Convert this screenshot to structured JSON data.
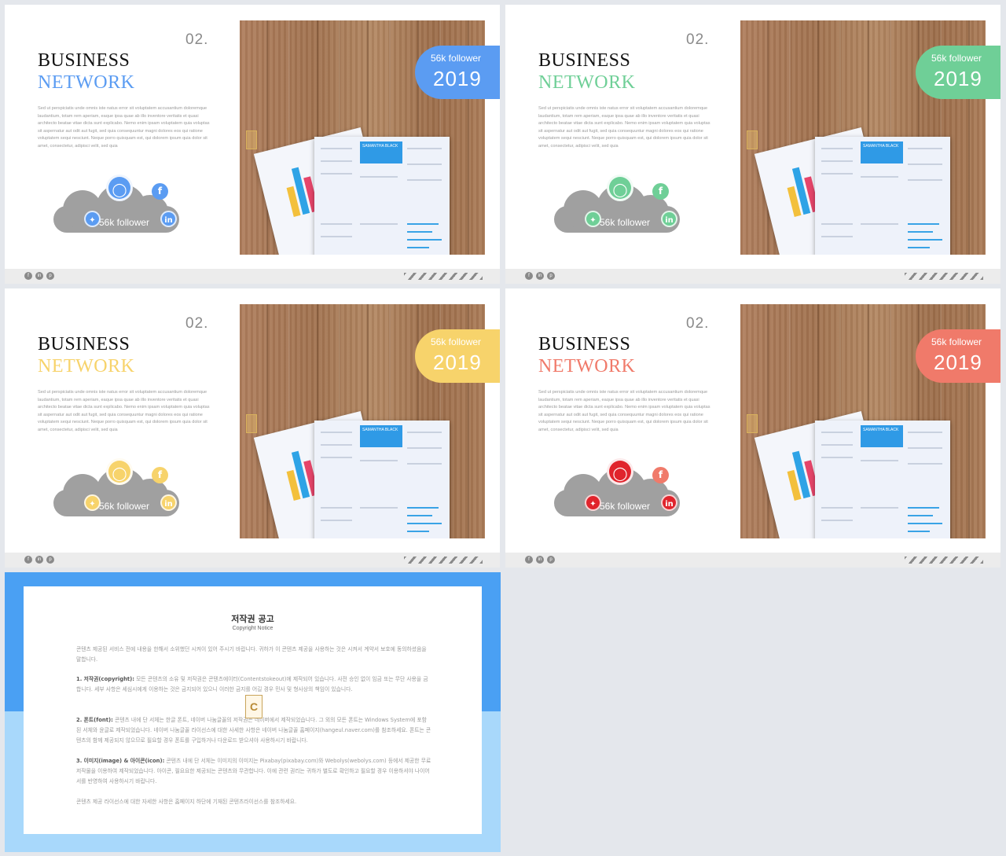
{
  "slides": [
    {
      "number": "02.",
      "title1": "BUSINESS",
      "title2": "NETWORK",
      "accent": "#5b9cf2",
      "badge_label": "56k follower",
      "badge_year": "2019",
      "cloud_label": "56k follower",
      "body": "Sed ut perspiciatis unde omnis iste natus error sit voluptatem accusantium doloremque laudantium, totam rem aperiam, eaque ipsa quae ab illo inventore veritatis et quasi architecto beatae vitae dicta sunt explicabo. Nemo enim ipsam voluptatem quia voluptas sit aspernatur aut odit aut fugit, sed quia consequuntur magni dolores eos qui ratione voluptatem sequi nesciunt. Neque porro quisquam est, qui dolorem ipsum quia dolor sit amet, consectetur, adipisci velit, sed quia"
    },
    {
      "number": "02.",
      "title1": "BUSINESS",
      "title2": "NETWORK",
      "accent": "#6fcf97",
      "badge_label": "56k follower",
      "badge_year": "2019",
      "cloud_label": "56k follower",
      "body": "Sed ut perspiciatis unde omnis iste natus error sit voluptatem accusantium doloremque laudantium, totam rem aperiam, eaque ipsa quae ab illo inventore veritatis et quasi architecto beatae vitae dicta sunt explicabo. Nemo enim ipsam voluptatem quia voluptas sit aspernatur aut odit aut fugit, sed quia consequuntur magni dolores eos qui ratione voluptatem sequi nesciunt. Neque porro quisquam est, qui dolorem ipsum quia dolor sit amet, consectetur, adipisci velit, sed quia"
    },
    {
      "number": "02.",
      "title1": "BUSINESS",
      "title2": "NETWORK",
      "accent": "#f7d36b",
      "badge_label": "56k follower",
      "badge_year": "2019",
      "cloud_label": "56k follower",
      "body": "Sed ut perspiciatis unde omnis iste natus error sit voluptatem accusantium doloremque laudantium, totam rem aperiam, eaque ipsa quae ab illo inventore veritatis et quasi architecto beatae vitae dicta sunt explicabo. Nemo enim ipsam voluptatem quia voluptas sit aspernatur aut odit aut fugit, sed quia consequuntur magni dolores eos qui ratione voluptatem sequi nesciunt. Neque porro quisquam est, qui dolorem ipsum quia dolor sit amet, consectetur, adipisci velit, sed quia"
    },
    {
      "number": "02.",
      "title1": "BUSINESS",
      "title2": "NETWORK",
      "accent": "#f07a6a",
      "icon_accent": "#e0242c",
      "badge_label": "56k follower",
      "badge_year": "2019",
      "cloud_label": "56k follower",
      "body": "Sed ut perspiciatis unde omnis iste natus error sit voluptatem accusantium doloremque laudantium, totam rem aperiam, eaque ipsa quae ab illo inventore veritatis et quasi architecto beatae vitae dicta sunt explicabo. Nemo enim ipsam voluptatem quia voluptas sit aspernatur aut odit aut fugit, sed quia consequuntur magni dolores eos qui ratione voluptatem sequi nesciunt. Neque porro quisquam est, qui dolorem ipsum quia dolor sit amet, consectetur, adipisci velit, sed quia"
    }
  ],
  "resume": {
    "name": "SAMANTHA BLACK"
  },
  "copyright": {
    "title": "저작권 공고",
    "subtitle": "Copyright Notice",
    "intro": "콘텐츠 제공된 서비스 전에 내용을 한해서 소위했던 시켜이 있어 주시기 바랍니다. 귀하가 이 콘텐츠 제공을 사용하는 것은 시켜서 계약서 보호에 동의하셨음을 말합니다.",
    "p1_head": "1. 저작권(copyright):",
    "p1": "모든 콘텐츠의 소유 및 저작권은 콘텐츠에이터(Contentstokeout)에 제작되어 있습니다. 사전 승인 없이 임금 또는 무단 사용을 금합니다. 세부 사항은 세심시에게 이용하는 것은 금지되어 있으니 이러한 금지를 어길 경우 민사 및 형사상의 책임이 있습니다.",
    "p2_head": "2. 폰트(font):",
    "p2": "콘텐츠 내에 단 서체는 한글 폰트, 네이버 나눔글꼴의 저작권은 네이버에서 제작되었습니다. 그 외의 모든 폰트는 Windows System에 포함된 서체와 윤글로 제작되었습니다. 네이버 나눔글꼴 라이선스에 대한 사세한 사항은 네이버 나눔글꼴 홈페이지(hangeul.naver.com)를 참조하세요. 폰트는 콘텐츠의 함께 제공되지 않으므로 필요할 경우 폰트를 구입하거나 다운로드 받으셔야 사용하시기 바랍니다.",
    "p3_head": "3. 이미지(image) & 아이콘(icon):",
    "p3": "콘텐츠 내에 단 서체는 이미지의 이미지는 Pixabay(pixabay.com)와 Webolys(webolys.com) 등에서 제공한 무료 저작물을 이용하여 제작되었습니다. 아이콘, 필요요한 제공되는 콘텐츠와 무관합니다. 이에 관련 권리는 귀하가 별도로 확인하고 필요할 경우 이용하셔야 나이어서를 반영하여 사용하시기 바랍니다.",
    "outro": "콘텐츠 제공 라이선스에 대한 자세한 사항은 홈페이지 하단에 기재된 콘텐츠라이선스를 참조하세요.",
    "logo_letter": "C"
  }
}
